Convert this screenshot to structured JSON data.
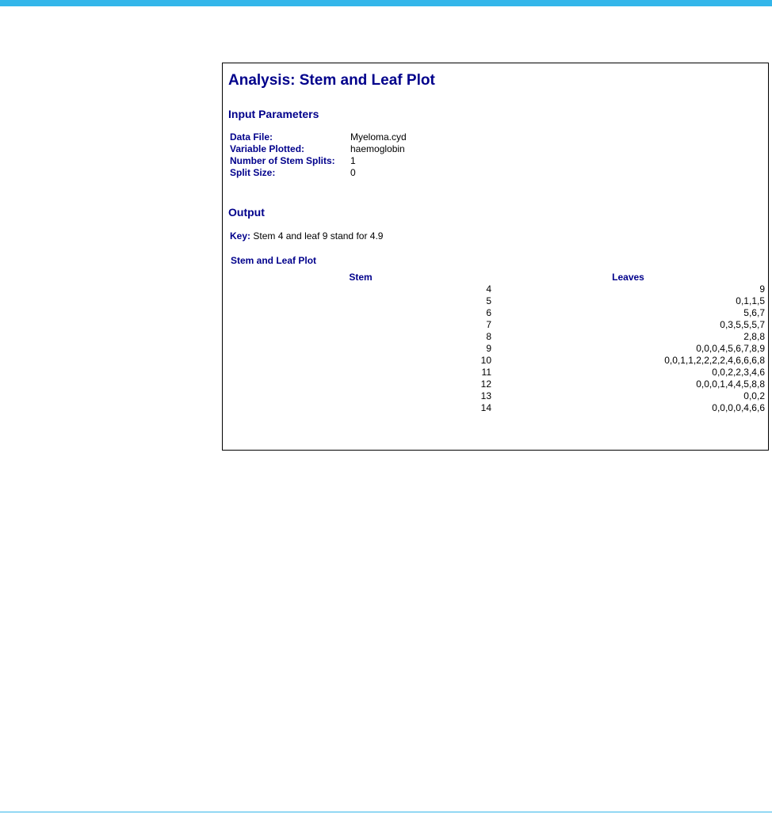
{
  "colors": {
    "accent_bar": "#33b6ea",
    "heading": "#00008b",
    "text": "#000000",
    "border": "#000000"
  },
  "analysis": {
    "title": "Analysis: Stem and Leaf Plot",
    "input_section_title": "Input Parameters",
    "params": [
      {
        "label": "Data File:",
        "value": "Myeloma.cyd"
      },
      {
        "label": "Variable Plotted:",
        "value": "haemoglobin"
      },
      {
        "label": "Number of Stem Splits:",
        "value": "1"
      },
      {
        "label": "Split Size:",
        "value": "0"
      }
    ],
    "output_section_title": "Output",
    "key_label": "Key:",
    "key_text": "Stem 4 and leaf 9 stand for 4.9",
    "plot_caption": "Stem and Leaf Plot",
    "columns": {
      "stem": "Stem",
      "leaves": "Leaves"
    },
    "rows": [
      {
        "stem": "4",
        "leaves": "9"
      },
      {
        "stem": "5",
        "leaves": "0,1,1,5"
      },
      {
        "stem": "6",
        "leaves": "5,6,7"
      },
      {
        "stem": "7",
        "leaves": "0,3,5,5,5,7"
      },
      {
        "stem": "8",
        "leaves": "2,8,8"
      },
      {
        "stem": "9",
        "leaves": "0,0,0,4,5,6,7,8,9"
      },
      {
        "stem": "10",
        "leaves": "0,0,1,1,2,2,2,2,4,6,6,6,8"
      },
      {
        "stem": "11",
        "leaves": "0,0,2,2,3,4,6"
      },
      {
        "stem": "12",
        "leaves": "0,0,0,1,4,4,5,8,8"
      },
      {
        "stem": "13",
        "leaves": "0,0,2"
      },
      {
        "stem": "14",
        "leaves": "0,0,0,0,4,6,6"
      }
    ]
  }
}
